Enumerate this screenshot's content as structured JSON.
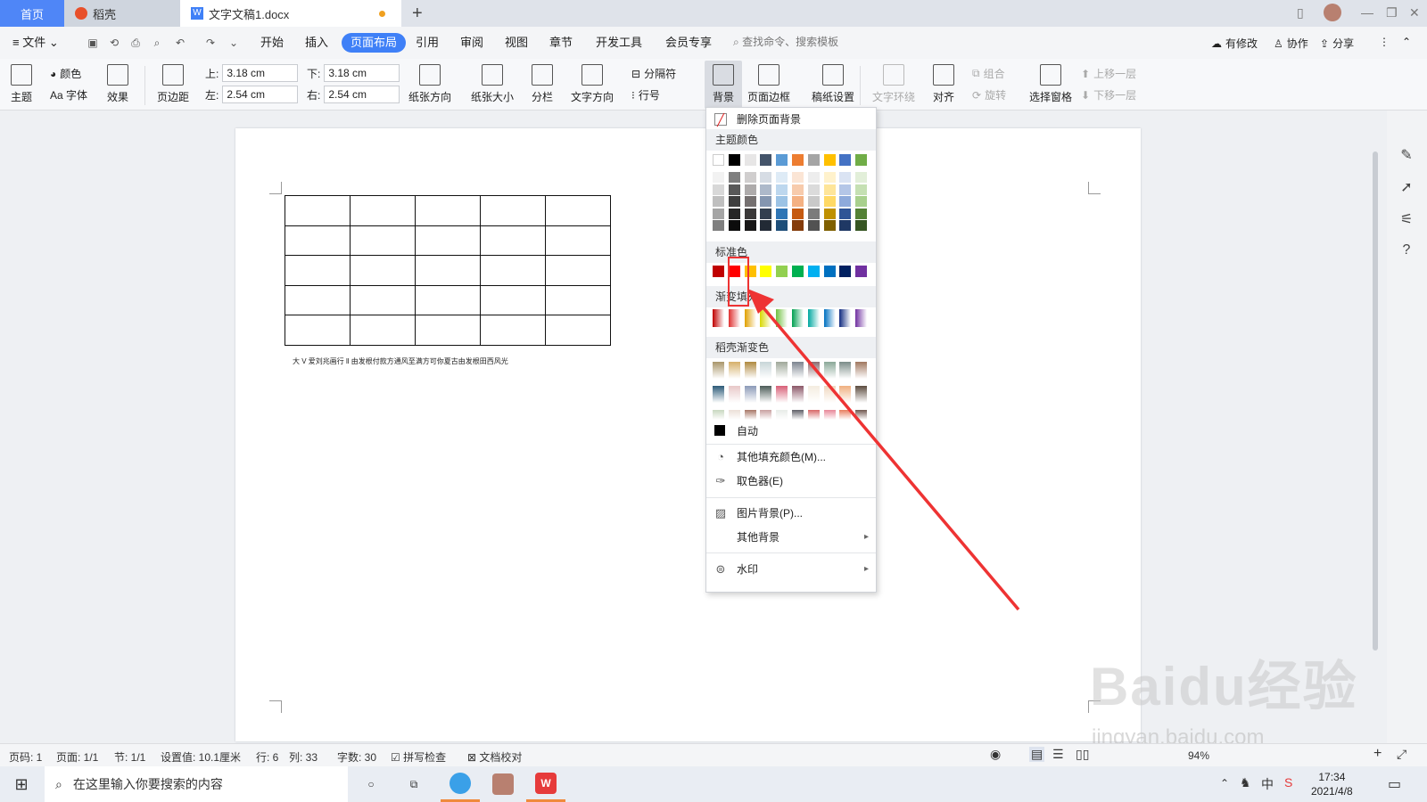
{
  "tabs": {
    "home": "首页",
    "daoke": "稻壳",
    "doc": "文字文稿1.docx",
    "new": "+"
  },
  "menubar": {
    "file": "文件",
    "items": [
      "开始",
      "插入",
      "页面布局",
      "引用",
      "审阅",
      "视图",
      "章节",
      "开发工具",
      "会员专享"
    ],
    "active": "页面布局",
    "search": "查找命令、搜索模板",
    "right": [
      "有修改",
      "协作",
      "分享"
    ]
  },
  "ribbon": {
    "theme": "主题",
    "color": "颜色",
    "font": "Aa 字体",
    "effect": "效果",
    "margins": "页边距",
    "top_label": "上:",
    "top_val": "3.18 cm",
    "bottom_label": "下:",
    "bottom_val": "3.18 cm",
    "left_label": "左:",
    "left_val": "2.54 cm",
    "right_label": "右:",
    "right_val": "2.54 cm",
    "orientation": "纸张方向",
    "size": "纸张大小",
    "columns": "分栏",
    "text_dir": "文字方向",
    "breaks": "分隔符",
    "line_num": "行号",
    "background": "背景",
    "page_border": "页面边框",
    "grid_paper": "稿纸设置",
    "wrap": "文字环绕",
    "align": "对齐",
    "group": "组合",
    "rotate": "旋转",
    "select_pane": "选择窗格",
    "bring_forward": "上移一层",
    "send_backward": "下移一层"
  },
  "document": {
    "table_rows": 5,
    "table_cols": 5,
    "text": "大 V 爱刘兆画行 ll 由发根付款方通风至满方可你夏古由发根田西风光"
  },
  "dropdown": {
    "remove_bg": "删除页面背景",
    "theme_colors": "主题颜色",
    "standard_colors": "标准色",
    "gradient_fill": "渐变填充",
    "daoke_gradient": "稻壳渐变色",
    "auto": "自动",
    "more_fill": "其他填充颜色(M)...",
    "eyedropper": "取色器(E)",
    "picture_bg": "图片背景(P)...",
    "other_bg": "其他背景",
    "watermark": "水印",
    "theme_top": [
      "#ffffff",
      "#000000",
      "#e7e6e6",
      "#44546a",
      "#5b9bd5",
      "#ed7d31",
      "#a5a5a5",
      "#ffc000",
      "#4472c4",
      "#70ad47"
    ],
    "theme_shades": [
      [
        "#f2f2f2",
        "#7f7f7f",
        "#d0cece",
        "#d6dce4",
        "#deebf6",
        "#fbe5d5",
        "#ededed",
        "#fff2cc",
        "#dae3f3",
        "#e2efd9"
      ],
      [
        "#d8d8d8",
        "#595959",
        "#aeabab",
        "#adb9ca",
        "#bdd7ee",
        "#f7cbac",
        "#dbdbdb",
        "#fee599",
        "#b4c6e7",
        "#c5e0b3"
      ],
      [
        "#bfbfbf",
        "#3f3f3f",
        "#757070",
        "#8496b0",
        "#9cc3e5",
        "#f4b183",
        "#c9c9c9",
        "#ffd965",
        "#8eaadb",
        "#a8d08d"
      ],
      [
        "#a5a5a5",
        "#262626",
        "#3a3838",
        "#323f4f",
        "#2e75b5",
        "#c55a11",
        "#7b7b7b",
        "#bf9000",
        "#2f5496",
        "#538135"
      ],
      [
        "#7f7f7f",
        "#0c0c0c",
        "#171616",
        "#222a35",
        "#1e4e79",
        "#843c0b",
        "#525252",
        "#7f6000",
        "#1f3864",
        "#375623"
      ]
    ],
    "standard": [
      "#c00000",
      "#ff0000",
      "#ffc000",
      "#ffff00",
      "#92d050",
      "#00b050",
      "#00b0f0",
      "#0070c0",
      "#002060",
      "#7030a0"
    ],
    "gradients": [
      "#c00000",
      "#e03030",
      "#e0a000",
      "#d8d800",
      "#70c040",
      "#00a050",
      "#00a8a0",
      "#0070c0",
      "#102a80",
      "#7030a0"
    ],
    "daoke_rows": [
      [
        "#a9966a",
        "#d6b06a",
        "#b08a40",
        "#c8d6d8",
        "#9fa89a",
        "#7d8590",
        "#8a6c70",
        "#8aa898",
        "#7b8c88",
        "#a07860"
      ],
      [
        "#2c5a78",
        "#e8c8c8",
        "#8c9ab8",
        "#4c5c58",
        "#d86078",
        "#8c5868",
        "#f4ece0",
        "#f0d8c0",
        "#f0b080",
        "#5c4c40"
      ],
      [
        "#c8d8c0",
        "#ece0d8",
        "#a87868",
        "#c8a0a0",
        "#e8ece8",
        "#606068",
        "#d86868",
        "#e88898",
        "#e88060",
        "#705850"
      ]
    ]
  },
  "status": {
    "page_code": "页码: 1",
    "page": "页面: 1/1",
    "section": "节: 1/1",
    "setting": "设置值: 10.1厘米",
    "row": "行: 6",
    "col": "列: 33",
    "words": "字数: 30",
    "spell": "拼写检查",
    "proof": "文档校对",
    "zoom": "94%"
  },
  "taskbar": {
    "search": "在这里输入你要搜索的内容",
    "time": "17:34",
    "date": "2021/4/8"
  },
  "watermark": {
    "brand": "Baidu经验",
    "url": "jingyan.baidu.com"
  },
  "colors": {
    "accent": "#3f80f7",
    "highlight": "#ee3333"
  }
}
